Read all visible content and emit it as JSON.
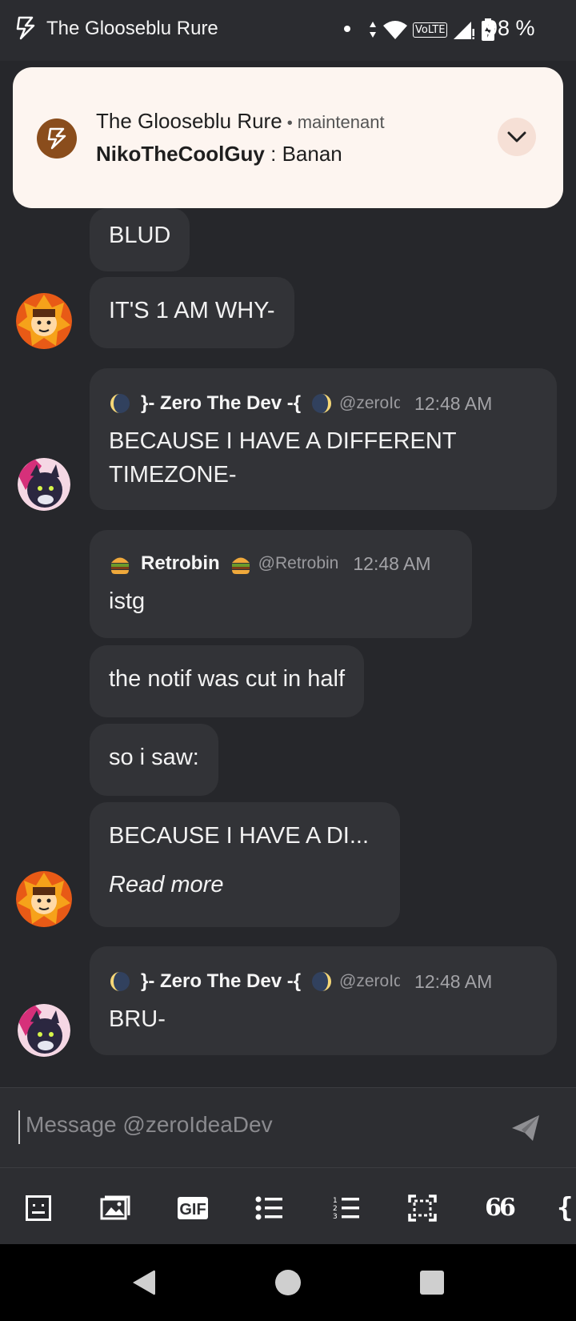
{
  "status_bar": {
    "app_title": "The Glooseblu Rure",
    "network_label": "VoLTE",
    "battery_text": "98 %",
    "icons": [
      "app-icon",
      "notification-dot",
      "data-arrows-icon",
      "wifi-icon",
      "volte-icon",
      "signal-icon",
      "battery-icon"
    ]
  },
  "notification": {
    "title": "The Glooseblu Rure",
    "separator": "•",
    "time": "maintenant",
    "sender": "NikoTheCoolGuy",
    "colon": " : ",
    "message": "Banan",
    "accent_color": "#8a4d1c"
  },
  "messages": [
    {
      "kind": "cont",
      "text": "BLUD"
    },
    {
      "kind": "cont",
      "text": "IT'S 1 AM WHY-"
    },
    {
      "kind": "full",
      "username": "}- Zero The Dev -{",
      "handle": "@zeroIdeaDev",
      "time": "12:48 AM",
      "lines": [
        "BECAUSE I HAVE A DIFFERENT",
        "TIMEZONE-"
      ]
    },
    {
      "kind": "full",
      "username": "Retrobin",
      "handle": "@Retrobin",
      "time": "12:48 AM",
      "lines": [
        "istg"
      ]
    },
    {
      "kind": "cont",
      "text": "the notif was cut in half"
    },
    {
      "kind": "cont",
      "text": "so i saw:"
    },
    {
      "kind": "cont",
      "text": "BECAUSE I HAVE A DI...",
      "read_more": "Read more"
    },
    {
      "kind": "full",
      "username": "}- Zero The Dev -{",
      "handle": "@zeroIdeaDev",
      "time": "12:48 AM",
      "lines": [
        "BRU-"
      ]
    }
  ],
  "input": {
    "placeholder": "Message @zeroIdeaDev"
  },
  "toolbar": {
    "gif_label": "GIF",
    "quote_glyph": "66",
    "brace_glyph": "{",
    "icons": [
      "emoji-icon",
      "image-icon",
      "gif-icon",
      "bullet-list-icon",
      "numbered-list-icon",
      "spoiler-icon",
      "quote-icon",
      "code-icon"
    ]
  },
  "colors": {
    "background": "#26272b",
    "bubble": "#323337",
    "notification_bg": "#fdf5f0"
  }
}
